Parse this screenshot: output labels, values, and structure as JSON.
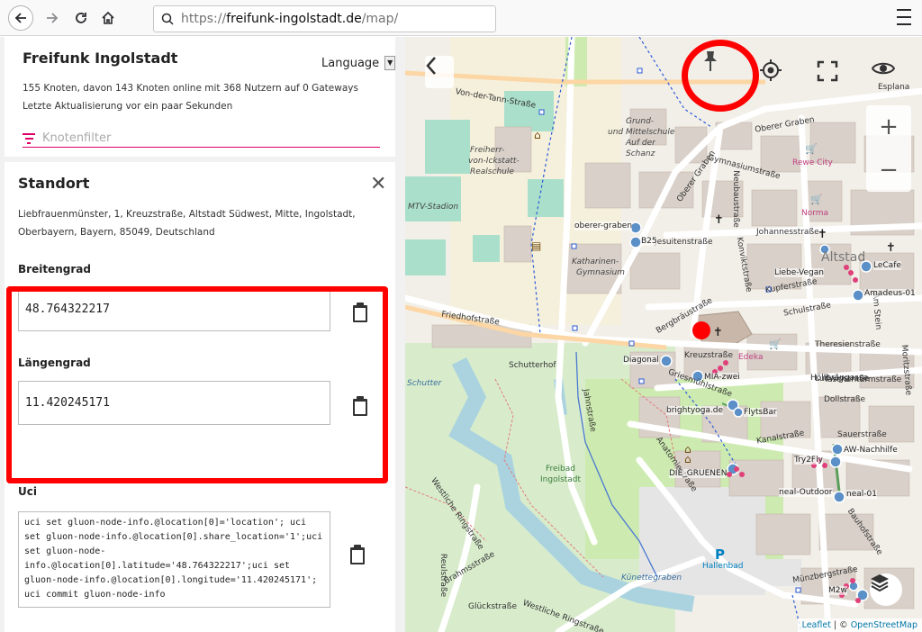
{
  "browser": {
    "url_scheme": "https://",
    "url_host": "freifunk-ingolstadt.de",
    "url_path": "/map/"
  },
  "sidebar": {
    "title": "Freifunk Ingolstadt",
    "language_label": "Language",
    "stats": "155 Knoten, davon 143 Knoten online mit 368 Nutzern auf 0 Gateways",
    "updated": "Letzte Aktualisierung vor ein paar Sekunden",
    "filter_placeholder": "Knotenfilter"
  },
  "location_card": {
    "title": "Standort",
    "address_line1": "Liebfrauenmünster, 1, Kreuzstraße, Altstadt Südwest, Mitte, Ingolstadt,",
    "address_line2": "Oberbayern, Bayern, 85049, Deutschland",
    "latitude_label": "Breitengrad",
    "latitude_value": "48.764322217",
    "longitude_label": "Längengrad",
    "longitude_value": "11.420245171",
    "uci_label": "Uci",
    "uci_text": "uci set gluon-node-info.@location[0]='location'; uci set gluon-node-info.@location[0].share_location='1';uci set gluon-node-info.@location[0].latitude='48.764322217';uci set gluon-node-info.@location[0].longitude='11.420245171'; uci commit gluon-node-info"
  },
  "map": {
    "labels": {
      "von_der_tann": "Von-der-Tann-Straße",
      "grund_schule": "Grund-",
      "mittelschule": "und Mittelschule",
      "auf_der": "Auf der",
      "schanz": "Schanz",
      "freiherr": "Freiherr-",
      "von_ickstatt": "von-Ickstatt-",
      "realschule": "Realschule",
      "mtv": "MTV-Stadion",
      "oberer_graben": "Oberer Graben",
      "gymnasium_str": "Gymnasiumstraße",
      "neubau_str": "Neubaustraße",
      "rewe": "Rewe City",
      "norma": "Norma",
      "johannes_str": "Johannesstraße",
      "jesuiten_str": "Jesuitenstraße",
      "konvikt_str": "Konviktstraße",
      "katharinen": "Katharinen-",
      "gymnasium": "Gymnasium",
      "altstadt": "Altstad",
      "kupferstr": "Kupferstraße",
      "schulstr": "Schulstraße",
      "friedhofstr": "Friedhofstraße",
      "bergbraeustr": "Bergbräustraße",
      "kreuzstr": "Kreuzstraße",
      "schutterhof": "Schutterhof",
      "schutter": "Schutter",
      "jahnstr": "Jahnstraße",
      "theresienstr": "Theresienstraße",
      "edeka": "Edeka",
      "griesmuehlstr": "Griesmühlstraße",
      "dollstr": "Dollstraße",
      "ludwigstr": "Ludwigstraße",
      "kanalstr": "Kanalstraße",
      "sauerstr": "Sauerstraße",
      "anatomiestr": "Anatomiestraße",
      "freibad": "Freibad",
      "ingolstadt": "Ingolstadt",
      "westliche_ring": "Westliche Ringstraße",
      "brahmsstr": "Brahmsstraße",
      "glueckstr": "Glückstraße",
      "reulstr": "Reulstraße",
      "kuenette": "Künettegraben",
      "hallenbad": "Hallenbad",
      "parking": "P",
      "muenzbergstr": "Münzbergstraße",
      "bauhofstr": "Bauhofstraße",
      "esplanade": "Esplana",
      "oberer_graben_2": "Oberer Graben",
      "hoellbraeugasse": "Höllbräugasse",
      "moritzstr": "Moritzstraße",
      "am_stein": "Am Stein",
      "taschenturmstr": "Taschenturmstraße"
    },
    "nodes": {
      "oberer_graben": "oberer-graben",
      "b25": "B25",
      "liebe_vegan": "Liebe-Vegan",
      "lecafe": "LeCafe",
      "amadeus": "Amadeus-01",
      "diagonal": "Diagonal",
      "mia_zwei": "MIA-zwei",
      "brightyoga": "brightyoga.de",
      "flytsbar": "FlytsBar",
      "aw_nachhilfe": "AW-Nachhilfe",
      "try2fly": "Try2Fly",
      "die_gruenen": "DIE_GRUENEN",
      "neal": "neal-Outdoor",
      "neal_01": "neal-01",
      "m2w": "M2w"
    },
    "attribution_leaflet": "Leaflet",
    "attribution_sep": " | © ",
    "attribution_osm": "OpenStreetMap"
  },
  "colors": {
    "accent": "#dc0067",
    "highlight": "#ff0000",
    "node_online": "#5b8fc7",
    "node_client": "#e0407a"
  }
}
